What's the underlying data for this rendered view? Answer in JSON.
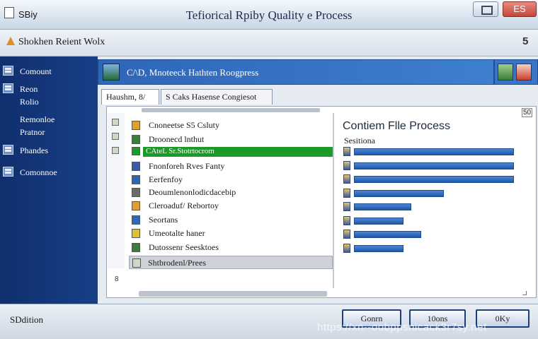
{
  "window": {
    "app_name": "SBiy",
    "title": "Tefiorical Rpiby Quality e Process",
    "close_label": "ES"
  },
  "subheader": {
    "title": "Shokhen Reient Wolx",
    "number": "5"
  },
  "sidebar": {
    "items": [
      {
        "label": "Comount",
        "sub": ""
      },
      {
        "label": "Reon",
        "sub": "Rolio"
      },
      {
        "label": "Remonloe",
        "sub": "Pratnor"
      },
      {
        "label": "Phandes",
        "sub": ""
      },
      {
        "label": "Comonnoe",
        "sub": ""
      }
    ]
  },
  "banner": {
    "text": "C/\\D, Mnoteeck Hathten Roogpress"
  },
  "tabs": [
    {
      "label": "Haushm, 8/"
    },
    {
      "label": "S Caks Hasense Congiesot"
    }
  ],
  "list": {
    "rows": [
      {
        "label": "Cnoneetse  S5 Csluty",
        "icon": "square-icon",
        "color": "#e0a030"
      },
      {
        "label": "Droonecd lnthut",
        "icon": "square-icon",
        "color": "#3b7c3a"
      },
      {
        "label": "CAteL Sr.Stotrtocrom",
        "icon": "square-icon",
        "color": "#1c9a27",
        "selected": true
      },
      {
        "label": "Fnonforeh Rves Fanty",
        "icon": "square-icon",
        "color": "#3b5aa8"
      },
      {
        "label": "Eerfenfoy",
        "icon": "square-icon",
        "color": "#2e66b8"
      },
      {
        "label": "Deoumlenonlodicdacebip",
        "icon": "square-icon",
        "color": "#6a6a6a"
      },
      {
        "label": "Cleroaduf/ Rebortoy",
        "icon": "square-icon",
        "color": "#e0a030"
      },
      {
        "label": "Seortans",
        "icon": "square-icon",
        "color": "#2e66b8"
      },
      {
        "label": "Umeotalte haner",
        "icon": "square-icon",
        "color": "#e0c030"
      },
      {
        "label": "Dutossenr Seesktoes",
        "icon": "square-icon",
        "color": "#3b7c3a"
      }
    ],
    "footer_row": "Shtbrodenl/Prees"
  },
  "right_panel": {
    "title": "Contiem Flle Process",
    "subtitle": "Sesitiona",
    "bars": [
      {
        "fraction": 1.0
      },
      {
        "fraction": 1.0
      },
      {
        "fraction": 1.0
      },
      {
        "fraction": 0.56
      },
      {
        "fraction": 0.36
      },
      {
        "fraction": 0.31
      },
      {
        "fraction": 0.42
      },
      {
        "fraction": 0.31
      }
    ]
  },
  "panel_number": "50",
  "scroll_tag": "8",
  "status": {
    "text": "SDdition"
  },
  "buttons": [
    {
      "label": "Gonrn"
    },
    {
      "label": "10ons"
    },
    {
      "label": "0Ky"
    }
  ],
  "watermark": "https://xn--oobppsnicack3r7sy.net",
  "colors": {
    "sidebar": "#0f2f6e",
    "banner": "#2e66b8",
    "selection": "#1c9a27",
    "bar": "#1f57a8"
  }
}
